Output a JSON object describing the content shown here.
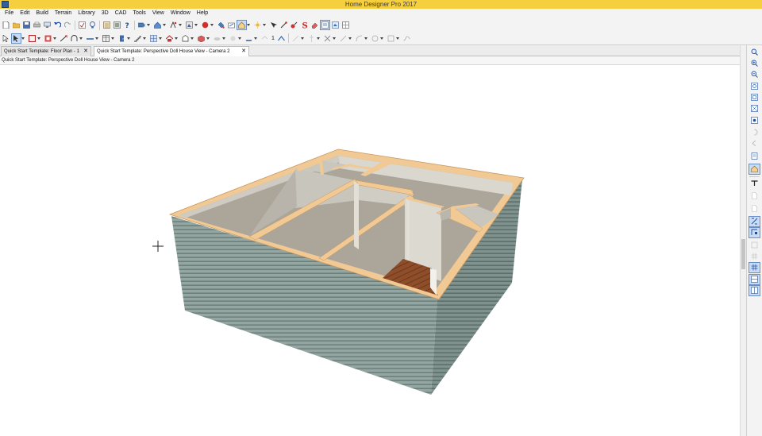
{
  "window": {
    "title": "Home Designer Pro 2017"
  },
  "menu": {
    "items": [
      "File",
      "Edit",
      "Build",
      "Terrain",
      "Library",
      "3D",
      "CAD",
      "Tools",
      "View",
      "Window",
      "Help"
    ]
  },
  "toolbar2": {
    "number_field": "1"
  },
  "tabs": [
    {
      "label": "Quick Start Template: Floor Plan - 1",
      "close": "✕",
      "active": false
    },
    {
      "label": "Quick Start Template: Perspective Doll House View - Camera 2",
      "close": "✕",
      "active": true
    }
  ],
  "view": {
    "header": "Quick Start Template: Perspective Doll House View - Camera 2"
  },
  "colors": {
    "titlebar": "#f5cf3e",
    "wall_top": "#f0c995",
    "interior_wall": "#d8d5cc",
    "floor": "#aca59a",
    "siding": "#8da09b",
    "hardwood": "#8b4a26",
    "selected_tool": "#c9dcf5"
  }
}
